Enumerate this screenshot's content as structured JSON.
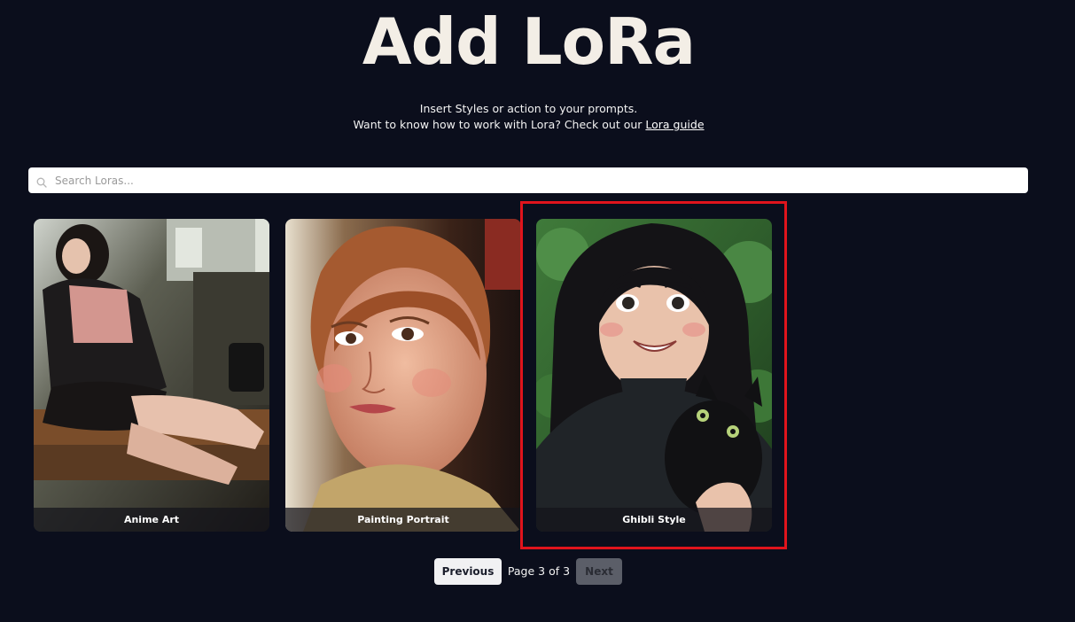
{
  "header": {
    "title": "Add LoRa",
    "subtitle_line1": "Insert Styles or action to your prompts.",
    "subtitle_line2_prefix": "Want to know how to work with Lora? Check out our ",
    "guide_link": "Lora guide"
  },
  "search": {
    "placeholder": "Search Loras...",
    "value": "",
    "icon": "search-icon"
  },
  "cards": [
    {
      "label": "Anime Art"
    },
    {
      "label": "Painting Portrait"
    },
    {
      "label": "Ghibli Style"
    }
  ],
  "pagination": {
    "previous_label": "Previous",
    "page_text": "Page 3 of 3",
    "next_label": "Next"
  },
  "colors": {
    "background": "#0b0e1c",
    "highlight": "#e0141c"
  }
}
